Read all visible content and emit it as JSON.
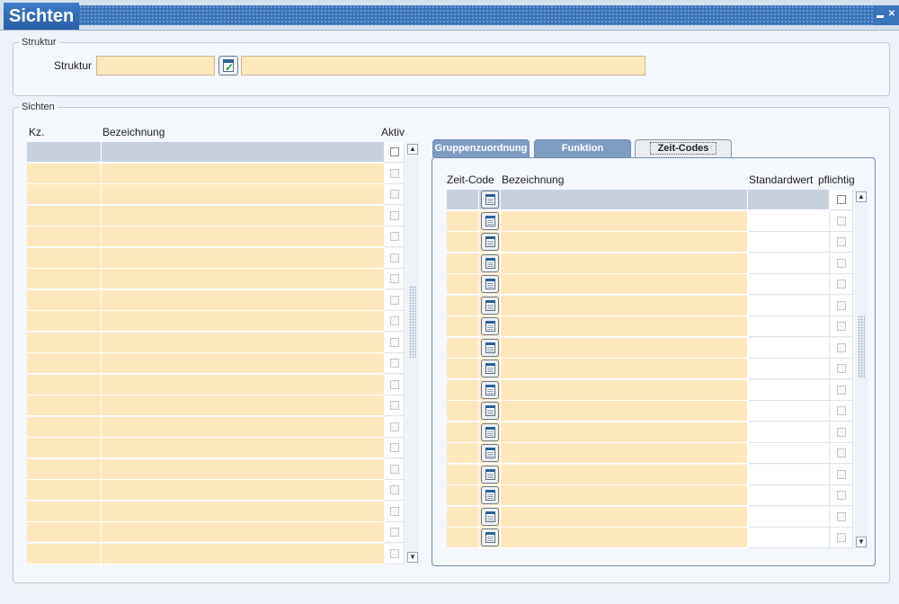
{
  "window": {
    "title": "Sichten"
  },
  "struktur_group": {
    "legend": "Struktur",
    "label": "Struktur",
    "code_value": "",
    "name_value": ""
  },
  "sichten_group": {
    "legend": "Sichten",
    "columns": {
      "kz": "Kz.",
      "bezeichnung": "Bezeichnung",
      "aktiv": "Aktiv"
    },
    "row_count": 20
  },
  "tabs": [
    {
      "label": "Gruppenzuordnung",
      "active": false
    },
    {
      "label": "Funktion",
      "active": false
    },
    {
      "label": "Zeit-Codes",
      "active": true
    }
  ],
  "zeitcodes": {
    "columns": {
      "zeit_code": "Zeit-Code",
      "bezeichnung": "Bezeichnung",
      "standardwert": "Standardwert",
      "pflichtig": "pflichtig"
    },
    "row_count": 17
  },
  "colors": {
    "title_bar": "#2a5fa5",
    "entry_field": "#fde8bd",
    "selected_row": "#c7d1de",
    "tab_inactive": "#7e9cc2"
  },
  "icons": {
    "lov_button": "calendar-check-icon",
    "row_button": "calendar-list-icon",
    "minimize": "minimize-icon",
    "close": "close-icon"
  }
}
